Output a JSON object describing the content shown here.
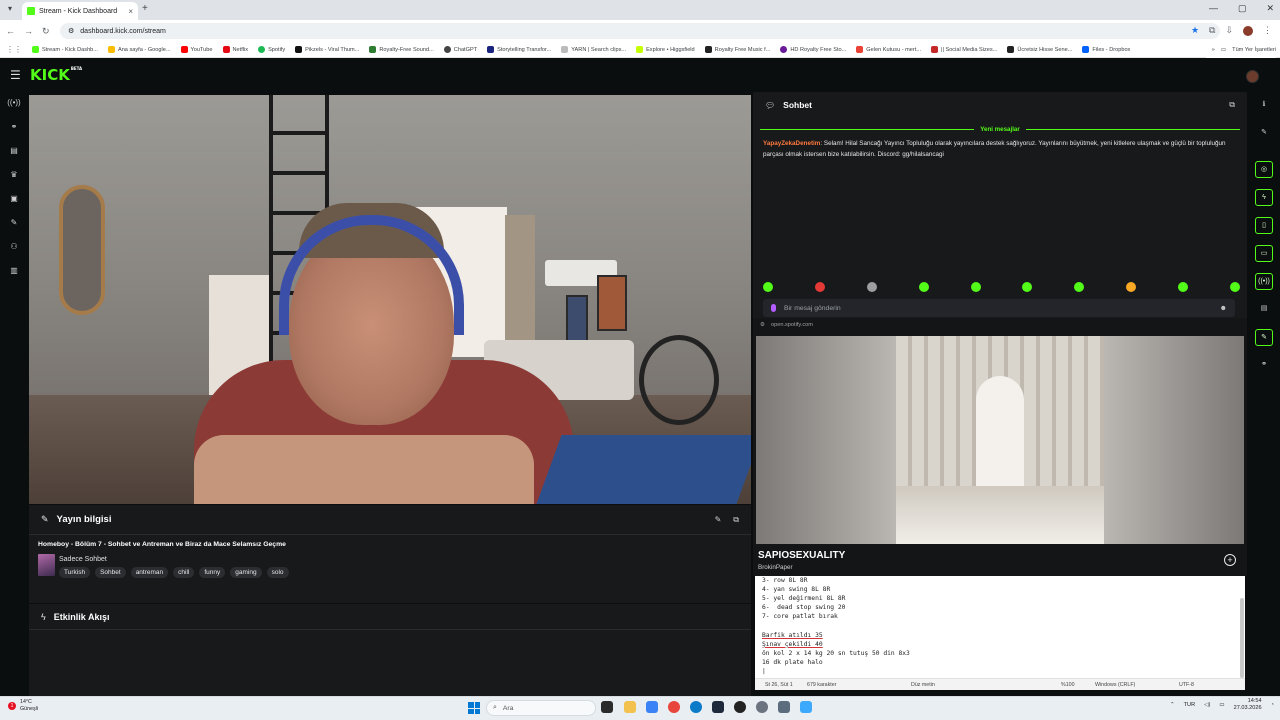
{
  "browser": {
    "tab_title": "Stream - Kick Dashboard",
    "tab_close": "×",
    "new_tab": "+",
    "url": "dashboard.kick.com/stream",
    "bookmarks": [
      {
        "label": "Stream - Kick Dashb...",
        "color": "#53fc18"
      },
      {
        "label": "Ana sayfa - Google...",
        "color": "#fbbc04"
      },
      {
        "label": "YouTube",
        "color": "#ff0000"
      },
      {
        "label": "Netflix",
        "color": "#e50914"
      },
      {
        "label": "Spotify",
        "color": "#1db954"
      },
      {
        "label": "Pikzels - Viral Thum...",
        "color": "#111111"
      },
      {
        "label": "Royalty-Free Sound...",
        "color": "#2e7d32"
      },
      {
        "label": "ChatGPT",
        "color": "#444444"
      },
      {
        "label": "Storytelling Transfor...",
        "color": "#1a237e"
      },
      {
        "label": "YARN | Search clips...",
        "color": "#aaaaaa"
      },
      {
        "label": "Explore • Higgsfield",
        "color": "#c6ff00"
      },
      {
        "label": "Royalty Free Music f...",
        "color": "#222222"
      },
      {
        "label": "HD Royalty Free Sto...",
        "color": "#6a1b9a"
      },
      {
        "label": "Gelen Kutusu - mert...",
        "color": "#ea4335"
      },
      {
        "label": "|| Social Media Sizes...",
        "color": "#c62828"
      },
      {
        "label": "Ücretsiz Hisse Sene...",
        "color": "#222222"
      },
      {
        "label": "Files - Dropbox",
        "color": "#0061ff"
      }
    ],
    "bookmarks_more": "»",
    "all_bookmarks": "Tüm Yer İşaretleri"
  },
  "header": {
    "logo": "KICK",
    "logo_beta": "BETA"
  },
  "left_rail": {
    "icons": [
      "stream-icon",
      "link-icon",
      "layout-icon",
      "trophy-icon",
      "media-icon",
      "tools-icon",
      "community-icon",
      "analytics-icon"
    ]
  },
  "stream_info": {
    "section_title": "Yayın bilgisi",
    "title": "Homeboy - Bölüm 7 - Sohbet ve Antreman ve Biraz da Mace Selamsız Geçme",
    "category": "Sadece Sohbet",
    "tags": [
      "Turkish",
      "Sohbet",
      "antreman",
      "chill",
      "funny",
      "gaming",
      "solo"
    ]
  },
  "activity": {
    "section_title": "Etkinlik Akışı"
  },
  "chat": {
    "title": "Sohbet",
    "new_messages": "Yeni mesajlar",
    "message_user": "YapayZekaDenetim",
    "message_text": ": Selam! Hilal Sancağı Yayıncı Topluluğu olarak yayıncılara destek sağlıyoruz. Yayınlarını büyütmek, yeni kitlelere ulaşmak ve güçlü bir topluluğun parçası olmak istersen bize katılabilirsin. Discord: gg/hilalsancagi",
    "input_placeholder": "Bir mesaj gönderin",
    "emote_colors": [
      "#53fc18",
      "#e53935",
      "#9e9e9e",
      "#53fc18",
      "#53fc18",
      "#53fc18",
      "#53fc18",
      "#f9a825",
      "#53fc18",
      "#53fc18"
    ]
  },
  "media": {
    "source": "open.spotify.com",
    "track_title": "SAPIOSEXUALITY",
    "artist": "BrokinPaper",
    "add_symbol": "+"
  },
  "notepad": {
    "lines": [
      "3- row 8L 8R",
      "4- yan swing 8L 8R",
      "5- yel değirmeni 8L 8R",
      "6-  dead stop swing 20",
      "7- core patlat bırak",
      "",
      "Barfik atıldı 35",
      "Şınav çekildi 40",
      "ön kol 2 x 14 kg 20 sn tutuş 50 din 8x3",
      "16 dk plate halo",
      "|"
    ],
    "status": {
      "position": "St 26, Süt 1",
      "chars": "679 karakter",
      "mode": "Düz metin",
      "zoom": "%100",
      "line_endings": "Windows (CRLF)",
      "encoding": "UTF-8"
    }
  },
  "taskbar": {
    "weather_temp": "14°C",
    "weather_desc": "Güneşli",
    "search_label": "Ara",
    "language": "TUR",
    "time": "14:54",
    "date": "27.03.2026"
  }
}
